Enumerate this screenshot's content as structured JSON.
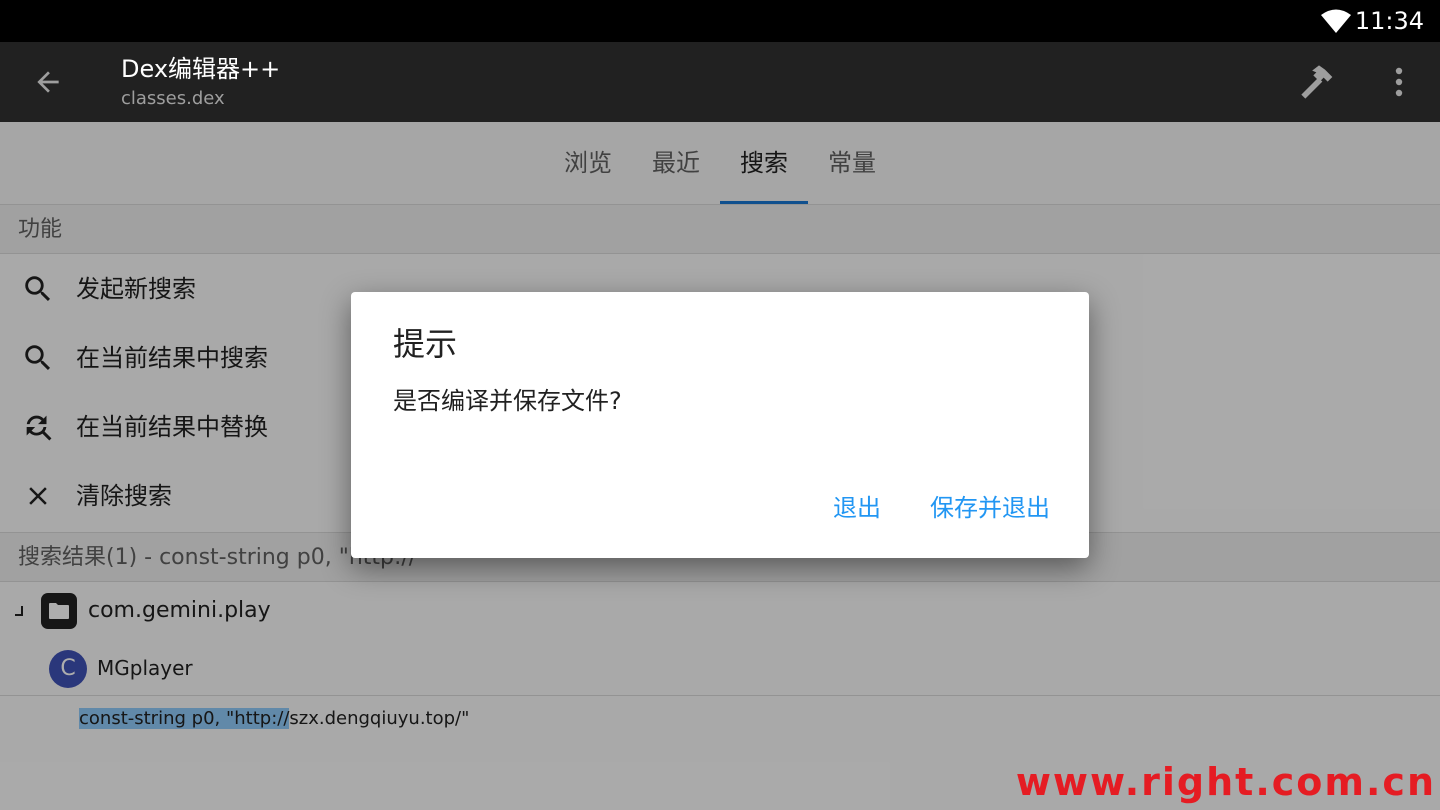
{
  "status_bar": {
    "time": "11:34"
  },
  "app_bar": {
    "title": "Dex编辑器++",
    "subtitle": "classes.dex"
  },
  "tabs": [
    {
      "label": "浏览"
    },
    {
      "label": "最近"
    },
    {
      "label": "搜索",
      "active": true
    },
    {
      "label": "常量"
    }
  ],
  "functions_section": {
    "header": "功能",
    "items": [
      {
        "label": "发起新搜索",
        "icon": "search-icon"
      },
      {
        "label": "在当前结果中搜索",
        "icon": "search-icon"
      },
      {
        "label": "在当前结果中替换",
        "icon": "find-replace-icon"
      },
      {
        "label": "清除搜索",
        "icon": "close-icon"
      }
    ]
  },
  "results_section": {
    "header": "搜索结果(1) - const-string p0, \"http://",
    "package": "com.gemini.play",
    "class_badge": "C",
    "class_name": "MGplayer",
    "code_highlight": "const-string p0, \"http://",
    "code_rest": "szx.dengqiuyu.top/\""
  },
  "dialog": {
    "title": "提示",
    "message": "是否编译并保存文件?",
    "buttons": {
      "exit": "退出",
      "save_exit": "保存并退出"
    }
  },
  "watermark": "www.right.com.cn",
  "colors": {
    "accent": "#1976d2",
    "dialog_button": "#2196f3",
    "watermark": "#e51c23"
  }
}
